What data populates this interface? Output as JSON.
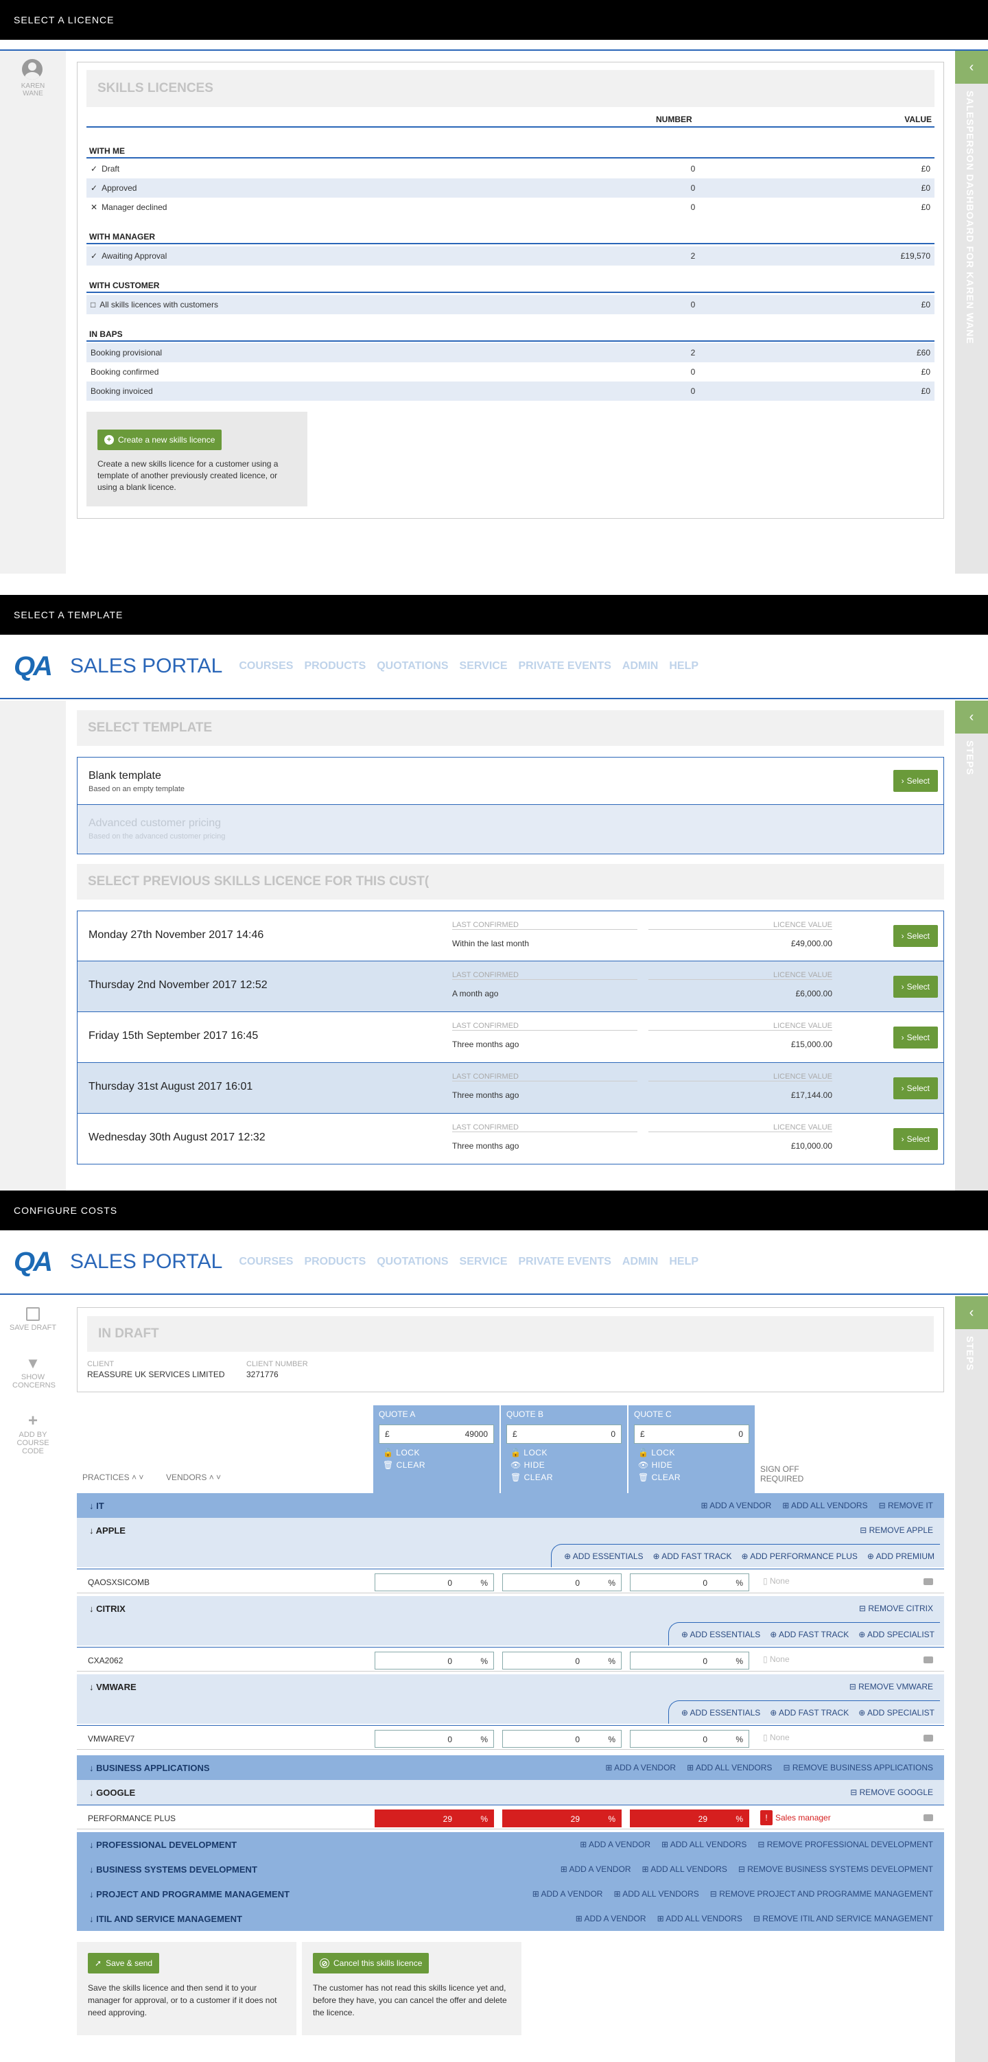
{
  "s1": {
    "bar": "SELECT A LICENCE",
    "user": "KAREN\nWANE",
    "title": "SKILLS LICENCES",
    "col_number": "NUMBER",
    "col_value": "VALUE",
    "groups": [
      {
        "name": "WITH ME",
        "rows": [
          {
            "icon": "✓",
            "label": "Draft",
            "number": "0",
            "value": "£0"
          },
          {
            "icon": "✓",
            "label": "Approved",
            "number": "0",
            "value": "£0"
          },
          {
            "icon": "✕",
            "label": "Manager declined",
            "number": "0",
            "value": "£0"
          }
        ]
      },
      {
        "name": "WITH MANAGER",
        "rows": [
          {
            "icon": "✓",
            "label": "Awaiting Approval",
            "number": "2",
            "value": "£19,570"
          }
        ]
      },
      {
        "name": "WITH CUSTOMER",
        "rows": [
          {
            "icon": "□",
            "label": "All skills licences with customers",
            "number": "0",
            "value": "£0"
          }
        ]
      },
      {
        "name": "IN BAPS",
        "rows": [
          {
            "icon": "",
            "label": "Booking provisional",
            "number": "2",
            "value": "£60"
          },
          {
            "icon": "",
            "label": "Booking confirmed",
            "number": "0",
            "value": "£0"
          },
          {
            "icon": "",
            "label": "Booking invoiced",
            "number": "0",
            "value": "£0"
          }
        ]
      }
    ],
    "create_btn": "Create a new skills licence",
    "create_desc": "Create a new skills licence for a customer using a template of another previously created licence, or using a blank licence.",
    "side_tab": "SALESPERSON DASHBOARD FOR KAREN WANE"
  },
  "s2": {
    "bar": "SELECT A TEMPLATE",
    "logo": "QA",
    "portal": "SALES PORTAL",
    "nav": [
      "COURSES",
      "PRODUCTS",
      "QUOTATIONS",
      "SERVICE",
      "PRIVATE EVENTS",
      "ADMIN",
      "HELP"
    ],
    "select_template": "SELECT TEMPLATE",
    "blank_title": "Blank template",
    "blank_sub": "Based on an empty template",
    "adv_title": "Advanced customer pricing",
    "adv_sub": "Based on the advanced customer pricing",
    "select_btn": "Select",
    "prev_title": "SELECT PREVIOUS SKILLS LICENCE FOR THIS CUST(",
    "last_confirmed": "LAST CONFIRMED",
    "licence_value": "LICENCE VALUE",
    "previous": [
      {
        "date": "Monday 27th November 2017 14:46",
        "confirmed": "Within the last month",
        "value": "£49,000.00"
      },
      {
        "date": "Thursday 2nd November 2017 12:52",
        "confirmed": "A month ago",
        "value": "£6,000.00"
      },
      {
        "date": "Friday 15th September 2017 16:45",
        "confirmed": "Three months ago",
        "value": "£15,000.00"
      },
      {
        "date": "Thursday 31st August 2017 16:01",
        "confirmed": "Three months ago",
        "value": "£17,144.00"
      },
      {
        "date": "Wednesday 30th August 2017 12:32",
        "confirmed": "Three months ago",
        "value": "£10,000.00"
      }
    ],
    "side_tab": "STEPS"
  },
  "s3": {
    "bar": "CONFIGURE COSTS",
    "save_draft": "SAVE DRAFT",
    "show_concerns": "SHOW CONCERNS",
    "add_by_code": "ADD BY COURSE CODE",
    "status": "IN DRAFT",
    "client_label": "CLIENT",
    "client": "REASSURE UK SERVICES LIMITED",
    "client_number_label": "CLIENT NUMBER",
    "client_number": "3271776",
    "quotes": [
      {
        "name": "QUOTE A",
        "value": "49000",
        "o1": "LOCK",
        "o2": "CLEAR"
      },
      {
        "name": "QUOTE B",
        "value": "0",
        "o1": "LOCK",
        "o2": "HIDE",
        "o3": "CLEAR"
      },
      {
        "name": "QUOTE C",
        "value": "0",
        "o1": "LOCK",
        "o2": "HIDE",
        "o3": "CLEAR"
      }
    ],
    "currency": "£",
    "practices": "PRACTICES",
    "vendors": "VENDORS",
    "signoff": "SIGN OFF REQUIRED",
    "it": "IT",
    "add_vendor": "ADD A VENDOR",
    "add_all": "ADD ALL VENDORS",
    "remove_it": "REMOVE IT",
    "apple": "APPLE",
    "remove_apple": "REMOVE APPLE",
    "add_essentials": "ADD ESSENTIALS",
    "add_fast": "ADD FAST TRACK",
    "add_perf": "ADD PERFORMANCE PLUS",
    "add_premium": "ADD PREMIUM",
    "apple_prod": "QAOSXSICOMB",
    "citrix": "CITRIX",
    "remove_citrix": "REMOVE CITRIX",
    "add_specialist": "ADD SPECIALIST",
    "citrix_prod": "CXA2062",
    "vmware": "VMWARE",
    "remove_vmware": "REMOVE VMWARE",
    "vmware_prod": "VMWAREV7",
    "pct": "%",
    "zero": "0",
    "none": "None",
    "ba": "BUSINESS APPLICATIONS",
    "remove_ba": "REMOVE BUSINESS APPLICATIONS",
    "google": "GOOGLE",
    "remove_google": "REMOVE GOOGLE",
    "google_prod": "PERFORMANCE PLUS",
    "google_val": "29",
    "sales_manager": "Sales manager",
    "pd": "PROFESSIONAL DEVELOPMENT",
    "remove_pd": "REMOVE PROFESSIONAL DEVELOPMENT",
    "bsd": "BUSINESS SYSTEMS DEVELOPMENT",
    "remove_bsd": "REMOVE BUSINESS SYSTEMS DEVELOPMENT",
    "ppm": "PROJECT AND PROGRAMME MANAGEMENT",
    "remove_ppm": "REMOVE PROJECT AND PROGRAMME MANAGEMENT",
    "itil": "ITIL AND SERVICE MANAGEMENT",
    "remove_itil": "REMOVE ITIL AND SERVICE MANAGEMENT",
    "save_send": "Save & send",
    "save_desc": "Save the skills licence and then send it to your manager for approval, or to a customer if it does not need approving.",
    "cancel": "Cancel this skills licence",
    "cancel_desc": "The customer has not read this skills licence yet and, before they have, you can cancel the offer and delete the licence.",
    "side_tab": "STEPS"
  }
}
